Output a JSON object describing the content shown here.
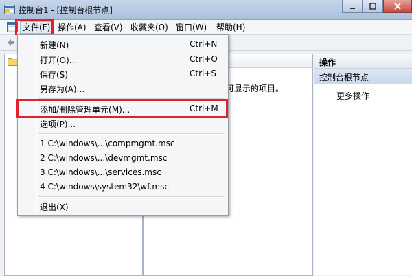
{
  "window": {
    "title": "控制台1 - [控制台根节点]"
  },
  "menubar": {
    "items": [
      "文件(F)",
      "操作(A)",
      "查看(V)",
      "收藏夹(O)",
      "窗口(W)",
      "帮助(H)"
    ]
  },
  "file_menu": {
    "new": {
      "label": "新建(N)",
      "shortcut": "Ctrl+N"
    },
    "open": {
      "label": "打开(O)...",
      "shortcut": "Ctrl+O"
    },
    "save": {
      "label": "保存(S)",
      "shortcut": "Ctrl+S"
    },
    "save_as": {
      "label": "另存为(A)..."
    },
    "add_remove": {
      "label": "添加/删除管理单元(M)...",
      "shortcut": "Ctrl+M"
    },
    "options": {
      "label": "选项(P)..."
    },
    "recent": [
      "1 C:\\windows\\...\\compmgmt.msc",
      "2 C:\\windows\\...\\devmgmt.msc",
      "3 C:\\windows\\...\\services.msc",
      "4 C:\\windows\\system32\\wf.msc"
    ],
    "exit": {
      "label": "退出(X)"
    }
  },
  "center_pane": {
    "text": "可显示的项目。"
  },
  "actions_pane": {
    "title": "操作",
    "root_item": "控制台根节点",
    "more": "更多操作"
  },
  "colors": {
    "highlight_frame": "#e0202a",
    "selected_row": "#c9d8ec"
  }
}
